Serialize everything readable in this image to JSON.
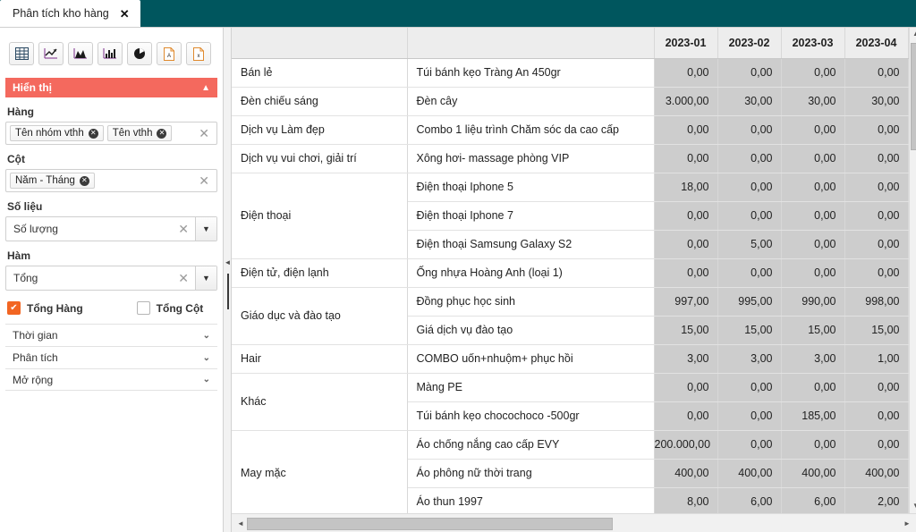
{
  "tab": {
    "title": "Phân tích kho hàng",
    "close_icon": "close-icon"
  },
  "toolbar": {
    "buttons": [
      {
        "name": "table-view-icon",
        "label": "Bảng"
      },
      {
        "name": "line-chart-icon",
        "label": "Biểu đồ đường"
      },
      {
        "name": "area-chart-icon",
        "label": "Biểu đồ miền"
      },
      {
        "name": "bar-chart-icon",
        "label": "Biểu đồ cột"
      },
      {
        "name": "pie-chart-icon",
        "label": "Biểu đồ tròn"
      },
      {
        "name": "pdf-export-icon",
        "label": "PDF"
      },
      {
        "name": "excel-export-icon",
        "label": "Excel"
      }
    ]
  },
  "panel": {
    "section_title": "Hiển thị",
    "collapse_icon": "chevron-up-icon",
    "rows_label": "Hàng",
    "rows_chips": [
      "Tên nhóm vthh",
      "Tên vthh"
    ],
    "cols_label": "Cột",
    "cols_chips": [
      "Năm - Tháng"
    ],
    "data_label": "Số liệu",
    "data_value": "Số lượng",
    "func_label": "Hàm",
    "func_value": "Tổng",
    "check_rowtotal": "Tổng Hàng",
    "check_coltotal": "Tổng Cột",
    "rowtotal_checked": true,
    "coltotal_checked": false,
    "accordions": [
      "Thời gian",
      "Phân tích",
      "Mở rộng"
    ],
    "accordion_icon": "chevron-down-icon"
  },
  "colors": {
    "titlebar": "#00565e",
    "section_header": "#f4695e",
    "checkbox_on": "#f26522",
    "data_cell_bg": "#cdcdcd",
    "header_bg": "#ededed"
  },
  "grid": {
    "headers": [
      "",
      "",
      "2023-01",
      "2023-02",
      "2023-03",
      "2023-04"
    ],
    "rows": [
      {
        "group": "Bán lẻ",
        "group_span": 1,
        "item": "Túi bánh kẹo Tràng An 450gr",
        "values": [
          "0,00",
          "0,00",
          "0,00",
          "0,00"
        ]
      },
      {
        "group": "Đèn chiếu sáng",
        "group_span": 1,
        "item": "Đèn cây",
        "values": [
          "3.000,00",
          "30,00",
          "30,00",
          "30,00"
        ]
      },
      {
        "group": "Dịch vụ Làm đẹp",
        "group_span": 1,
        "item": "Combo 1 liệu trình Chăm sóc da cao cấp",
        "values": [
          "0,00",
          "0,00",
          "0,00",
          "0,00"
        ]
      },
      {
        "group": "Dịch vụ vui chơi, giải trí",
        "group_span": 1,
        "item": "Xông hơi- massage phòng VIP",
        "values": [
          "0,00",
          "0,00",
          "0,00",
          "0,00"
        ]
      },
      {
        "group": "Điện thoại",
        "group_span": 3,
        "item": "Điện thoại Iphone 5",
        "values": [
          "18,00",
          "0,00",
          "0,00",
          "0,00"
        ]
      },
      {
        "group": null,
        "group_span": 0,
        "item": "Điện thoại Iphone 7",
        "values": [
          "0,00",
          "0,00",
          "0,00",
          "0,00"
        ]
      },
      {
        "group": null,
        "group_span": 0,
        "item": "Điện thoại Samsung Galaxy S2",
        "values": [
          "0,00",
          "5,00",
          "0,00",
          "0,00"
        ]
      },
      {
        "group": "Điện tử, điện lạnh",
        "group_span": 1,
        "item": "Ống nhựa Hoàng Anh (loại 1)",
        "values": [
          "0,00",
          "0,00",
          "0,00",
          "0,00"
        ]
      },
      {
        "group": "Giáo dục và đào tạo",
        "group_span": 2,
        "item": "Đồng phục học sinh",
        "values": [
          "997,00",
          "995,00",
          "990,00",
          "998,00"
        ]
      },
      {
        "group": null,
        "group_span": 0,
        "item": "Giá dịch vụ đào tạo",
        "values": [
          "15,00",
          "15,00",
          "15,00",
          "15,00"
        ]
      },
      {
        "group": "Hair",
        "group_span": 1,
        "item": "COMBO uốn+nhuộm+ phục hồi",
        "values": [
          "3,00",
          "3,00",
          "3,00",
          "1,00"
        ]
      },
      {
        "group": "Khác",
        "group_span": 2,
        "item": "Màng PE",
        "values": [
          "0,00",
          "0,00",
          "0,00",
          "0,00"
        ]
      },
      {
        "group": null,
        "group_span": 0,
        "item": "Túi bánh kẹo chocochoco -500gr",
        "values": [
          "0,00",
          "0,00",
          "185,00",
          "0,00"
        ]
      },
      {
        "group": "May mặc",
        "group_span": 3,
        "item": "Áo chống nắng cao cấp EVY",
        "values": [
          "200.000,00",
          "0,00",
          "0,00",
          "0,00"
        ]
      },
      {
        "group": null,
        "group_span": 0,
        "item": "Áo phông nữ thời trang",
        "values": [
          "400,00",
          "400,00",
          "400,00",
          "400,00"
        ]
      },
      {
        "group": null,
        "group_span": 0,
        "item": "Áo thun 1997",
        "values": [
          "8,00",
          "6,00",
          "6,00",
          "2,00"
        ]
      }
    ]
  },
  "scrollbars": {
    "v_up_icon": "chevron-up-icon",
    "v_down_icon": "chevron-down-icon",
    "h_left_icon": "chevron-left-icon",
    "h_right_icon": "chevron-right-icon"
  }
}
